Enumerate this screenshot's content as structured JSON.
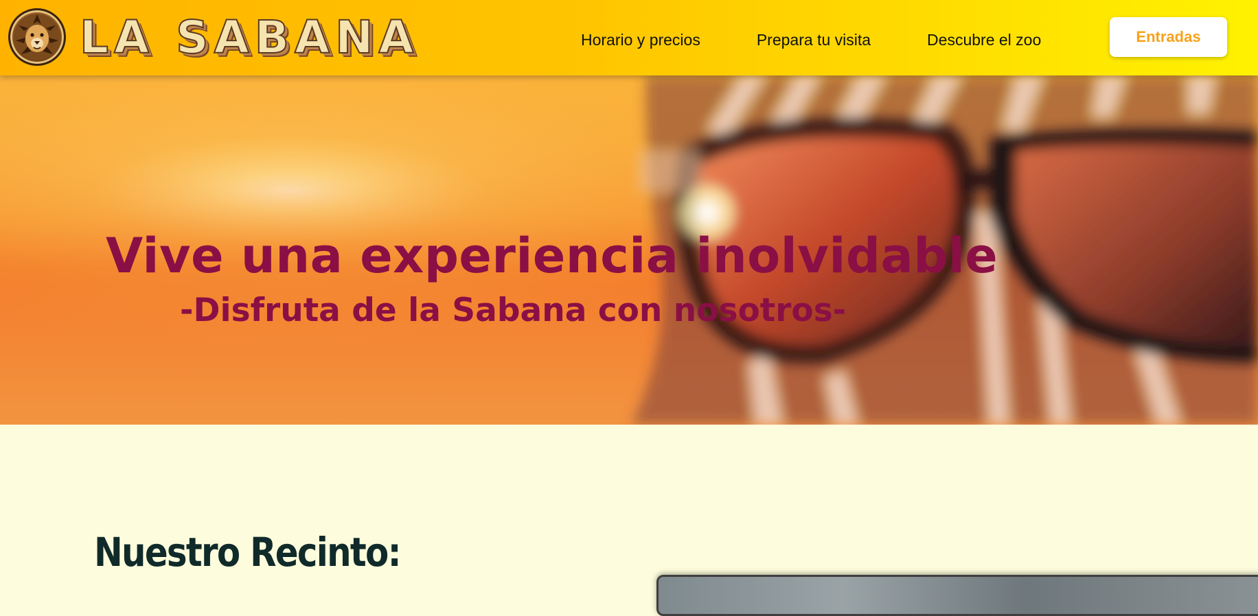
{
  "header": {
    "brand_name": "LA SABANA",
    "logo_icon": "lion-head-icon",
    "nav": [
      {
        "label": "Horario y precios"
      },
      {
        "label": "Prepara tu visita"
      },
      {
        "label": "Descubre el zoo"
      }
    ],
    "cta_label": "Entradas"
  },
  "hero": {
    "title": "Vive una experiencia inolvidable",
    "subtitle": "-Disfruta de la Sabana con nosotros-"
  },
  "section": {
    "title": "Nuestro Recinto:"
  },
  "colors": {
    "header_gradient_start": "#ffb300",
    "header_gradient_end": "#fff200",
    "hero_text": "#8a0f45",
    "cta_text": "#f7a21b",
    "page_background": "#fdfcdc",
    "section_title": "#102a2a"
  }
}
